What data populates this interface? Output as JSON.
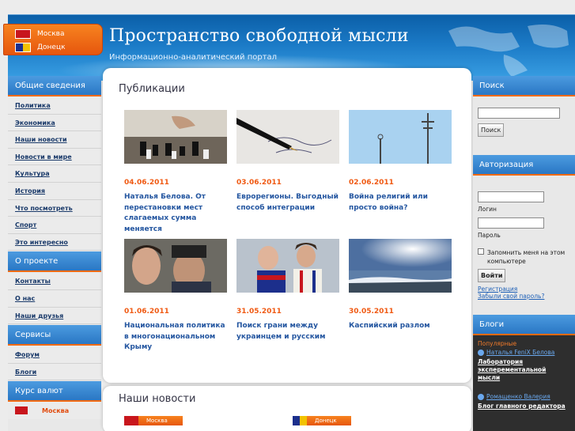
{
  "header": {
    "title": "Пространство свободной мысли",
    "subtitle": "Информационно-аналитический портал",
    "cities": [
      {
        "name": "Москва",
        "flag": "moscow-flag"
      },
      {
        "name": "Донецк",
        "flag": "donetsk-flag"
      }
    ]
  },
  "left_sidebar": {
    "general": {
      "heading": "Общие сведения",
      "items": [
        "Политика",
        "Экономика",
        "Наши новости",
        "Новости в мире",
        "Культура",
        "История",
        "Что посмотреть",
        "Спорт",
        "Это интересно"
      ]
    },
    "about": {
      "heading": "О проекте",
      "items": [
        "Контакты",
        "О нас",
        "Наши друзья"
      ]
    },
    "services": {
      "heading": "Сервисы",
      "items": [
        "Форум",
        "Блоги"
      ]
    },
    "currency": {
      "heading": "Курс валют",
      "city": "Москва"
    }
  },
  "main": {
    "publications_title": "Публикации",
    "publications": [
      {
        "date": "04.06.2011",
        "title": "Наталья Белова. От перестановки мест слагаемых сумма меняется",
        "image": "chess"
      },
      {
        "date": "03.06.2011",
        "title": "Еврорегионы. Выгодный способ интеграции",
        "image": "pen"
      },
      {
        "date": "02.06.2011",
        "title": "Война религий или просто война?",
        "image": "cross"
      },
      {
        "date": "01.06.2011",
        "title": "Национальная политика в многонациональном Крыму",
        "image": "people"
      },
      {
        "date": "31.05.2011",
        "title": "Поиск грани между украинцем и русским",
        "image": "men"
      },
      {
        "date": "30.05.2011",
        "title": "Каспийский разлом",
        "image": "sea"
      }
    ],
    "news_title": "Наши новости",
    "news_tabs": [
      "Москва",
      "Донецк"
    ]
  },
  "right_sidebar": {
    "search": {
      "heading": "Поиск",
      "button": "Поиск"
    },
    "auth": {
      "heading": "Авторизация",
      "login_label": "Логин",
      "password_label": "Пароль",
      "remember_label": "Запомнить меня на этом компьютере",
      "submit": "Войти",
      "register": "Регистрация",
      "forgot": "Забыли свой пароль?"
    },
    "blogs": {
      "heading": "Блоги",
      "popular": "Популярные",
      "entries": [
        {
          "user": "Наталья FeniX Белова",
          "title": "Лаборатория эксперементальной мысли"
        },
        {
          "user": "Ромащенко Валерия",
          "title": "Блог главного редактора"
        }
      ]
    }
  }
}
